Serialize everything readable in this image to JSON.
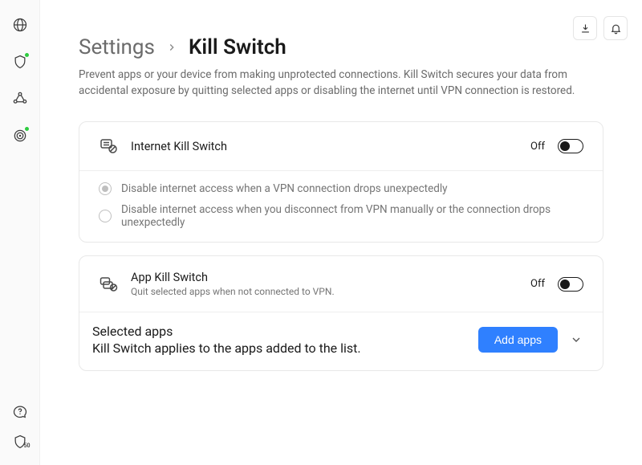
{
  "breadcrumb": {
    "parent": "Settings",
    "current": "Kill Switch"
  },
  "subtitle": "Prevent apps or your device from making unprotected connections. Kill Switch secures your data from accidental exposure by quitting selected apps or disabling the internet until VPN connection is restored.",
  "internet_ks": {
    "title": "Internet Kill Switch",
    "state": "Off",
    "options": [
      "Disable internet access when a VPN connection drops unexpectedly",
      "Disable internet access when you disconnect from VPN manually or the connection drops unexpectedly"
    ]
  },
  "app_ks": {
    "title": "App Kill Switch",
    "desc": "Quit selected apps when not connected to VPN.",
    "state": "Off"
  },
  "selected": {
    "title": "Selected apps",
    "desc": "Kill Switch applies to the apps added to the list.",
    "add_label": "Add apps"
  },
  "sidebar_badge": "50"
}
